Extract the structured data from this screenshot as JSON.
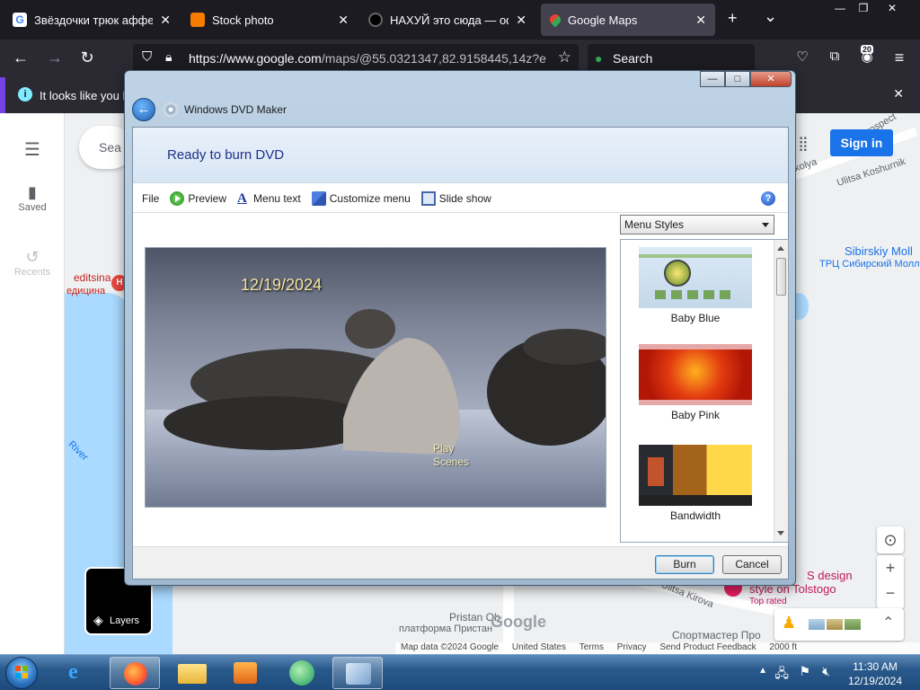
{
  "browser": {
    "tabs": [
      {
        "title": "Звёздочки трюк аффери",
        "favicon_color": "#4285f4",
        "active": false
      },
      {
        "title": "Stock photo",
        "favicon_color": "#f57c00",
        "active": false
      },
      {
        "title": "НАХУЙ это сюда — офиц",
        "favicon_color": "#000000",
        "active": false
      },
      {
        "title": "Google Maps",
        "favicon_color": "#34a853",
        "active": true
      }
    ],
    "new_tab": "+",
    "tab_list": "⌄",
    "url_domain": "https://www.google.com",
    "url_rest": "/maps/@55.0321347,82.9158445,14z?e",
    "search_label": "Search",
    "notification": "It looks like you h",
    "extension_badge": "20"
  },
  "maps": {
    "search_placeholder": "Sea",
    "saved_label": "Saved",
    "recents_label": "Recents",
    "sign_in": "Sign in",
    "layers_label": "Layers",
    "attribution": [
      "Map data ©2024 Google",
      "United States",
      "Terms",
      "Privacy",
      "Send Product Feedback",
      "2000 ft"
    ],
    "labels": {
      "mall": "Sibirskiy Moll",
      "mall_ru": "ТРЦ Сибирский Молл",
      "street1": "Ulitsa Koshurnik",
      "street2": "Ulitsa Kirova",
      "clinic_a": "editsina",
      "clinic_b": "едицина",
      "river": "River",
      "design": "S design",
      "style": "style on Tolstogo",
      "top_rated": "Top rated",
      "station": "Pristan Ob",
      "platform": "платформа Пристан",
      "sport": "Спортмастер Про",
      "kolya": "kolya",
      "cat": "Prospect"
    }
  },
  "dvd_maker": {
    "title": "Windows DVD Maker",
    "heading": "Ready to burn DVD",
    "toolbar": {
      "file": "File",
      "preview": "Preview",
      "menu_text": "Menu text",
      "customize": "Customize menu",
      "slideshow": "Slide show"
    },
    "preview": {
      "date": "12/19/2024",
      "play": "Play",
      "scenes": "Scenes"
    },
    "menu_styles_label": "Menu Styles",
    "styles": [
      {
        "name": "Baby Blue"
      },
      {
        "name": "Baby Pink"
      },
      {
        "name": "Bandwidth"
      }
    ],
    "burn": "Burn",
    "cancel": "Cancel",
    "window_buttons": {
      "minimize": "—",
      "maximize": "□",
      "close": "✕"
    }
  },
  "taskbar": {
    "time": "11:30 AM",
    "date": "12/19/2024"
  },
  "colors": {
    "accent": "#1a73e8",
    "dvd_heading": "#1e3287",
    "firefox_dark": "#1c1b22"
  }
}
